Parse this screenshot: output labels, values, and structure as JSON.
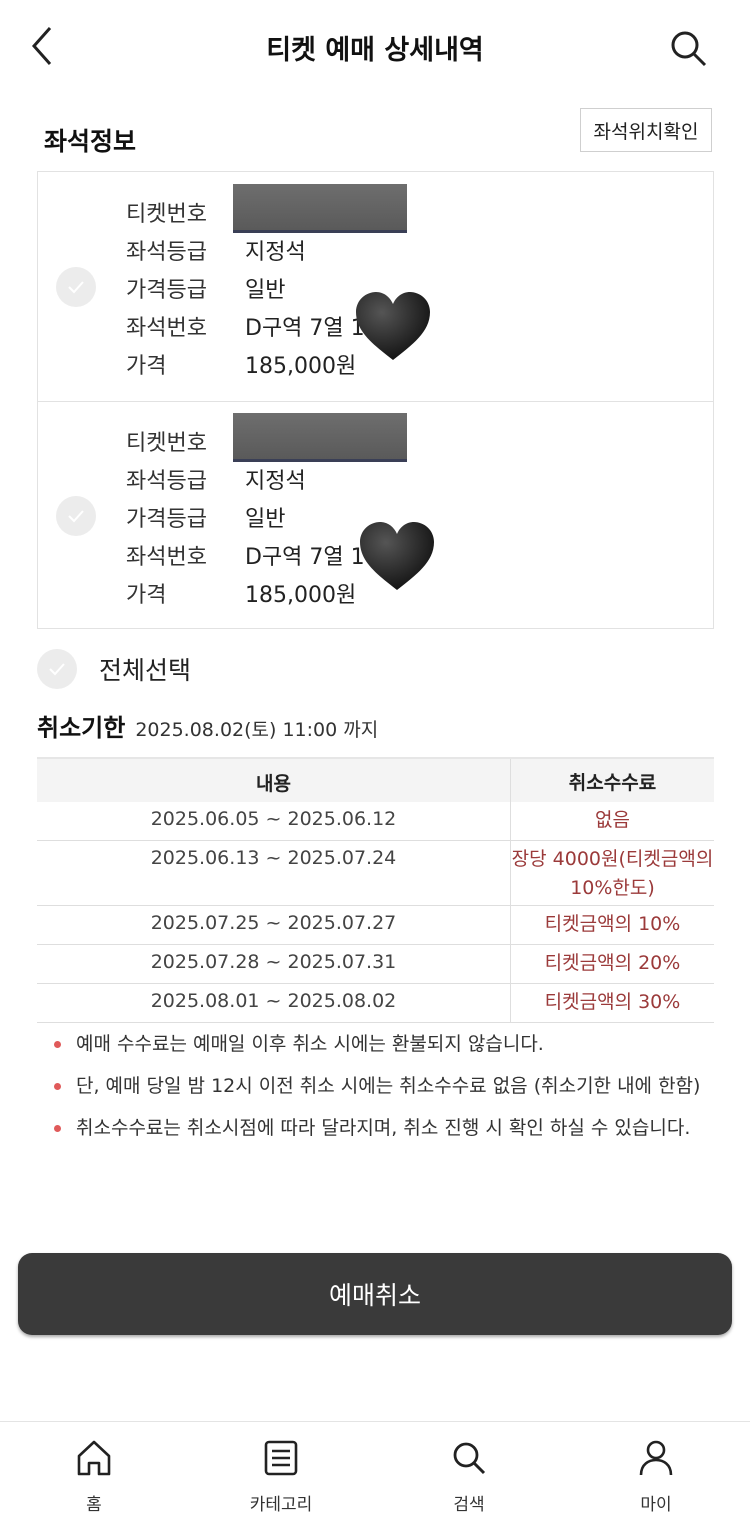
{
  "header": {
    "title": "티켓 예매 상세내역",
    "back_icon": "chevron-left-icon",
    "search_icon": "search-icon"
  },
  "seat_info": {
    "title": "좌석정보",
    "location_button": "좌석위치확인",
    "tickets": [
      {
        "rows": [
          {
            "label": "티켓번호",
            "value": ""
          },
          {
            "label": "좌석등급",
            "value": "지정석"
          },
          {
            "label": "가격등급",
            "value": "일반"
          },
          {
            "label": "좌석번호",
            "value": "D구역 7열 1"
          },
          {
            "label": "가격",
            "value": "185,000원"
          }
        ]
      },
      {
        "rows": [
          {
            "label": "티켓번호",
            "value": ""
          },
          {
            "label": "좌석등급",
            "value": "지정석"
          },
          {
            "label": "가격등급",
            "value": "일반"
          },
          {
            "label": "좌석번호",
            "value": "D구역 7열 1"
          },
          {
            "label": "가격",
            "value": "185,000원"
          }
        ]
      }
    ],
    "select_all": "전체선택"
  },
  "deadline": {
    "label": "취소기한",
    "value": "2025.08.02(토) 11:00 까지"
  },
  "fee_table": {
    "headers": [
      "내용",
      "취소수수료"
    ],
    "rows": [
      {
        "period": "2025.06.05 ~ 2025.06.12",
        "fee": "없음"
      },
      {
        "period": "2025.06.13 ~ 2025.07.24",
        "fee": "장당 4000원(티켓금액의 10%한도)"
      },
      {
        "period": "2025.07.25 ~ 2025.07.27",
        "fee": "티켓금액의 10%"
      },
      {
        "period": "2025.07.28 ~ 2025.07.31",
        "fee": "티켓금액의 20%"
      },
      {
        "period": "2025.08.01 ~ 2025.08.02",
        "fee": "티켓금액의 30%"
      }
    ]
  },
  "notes": [
    "예매 수수료는 예매일 이후 취소 시에는 환불되지 않습니다.",
    "단, 예매 당일 밤 12시 이전 취소 시에는 취소수수료 없음 (취소기한 내에 한함)",
    "취소수수료는 취소시점에 따라 달라지며, 취소 진행 시 확인 하실 수 있습니다."
  ],
  "cancel_button": "예매취소",
  "tabbar": [
    {
      "label": "홈",
      "icon": "home-icon"
    },
    {
      "label": "카테고리",
      "icon": "list-icon"
    },
    {
      "label": "검색",
      "icon": "search-icon"
    },
    {
      "label": "마이",
      "icon": "person-icon"
    }
  ],
  "colors": {
    "fee_text": "#9b3a3a",
    "button_bg": "#3a3a3a",
    "bullet": "#e05a5a"
  }
}
